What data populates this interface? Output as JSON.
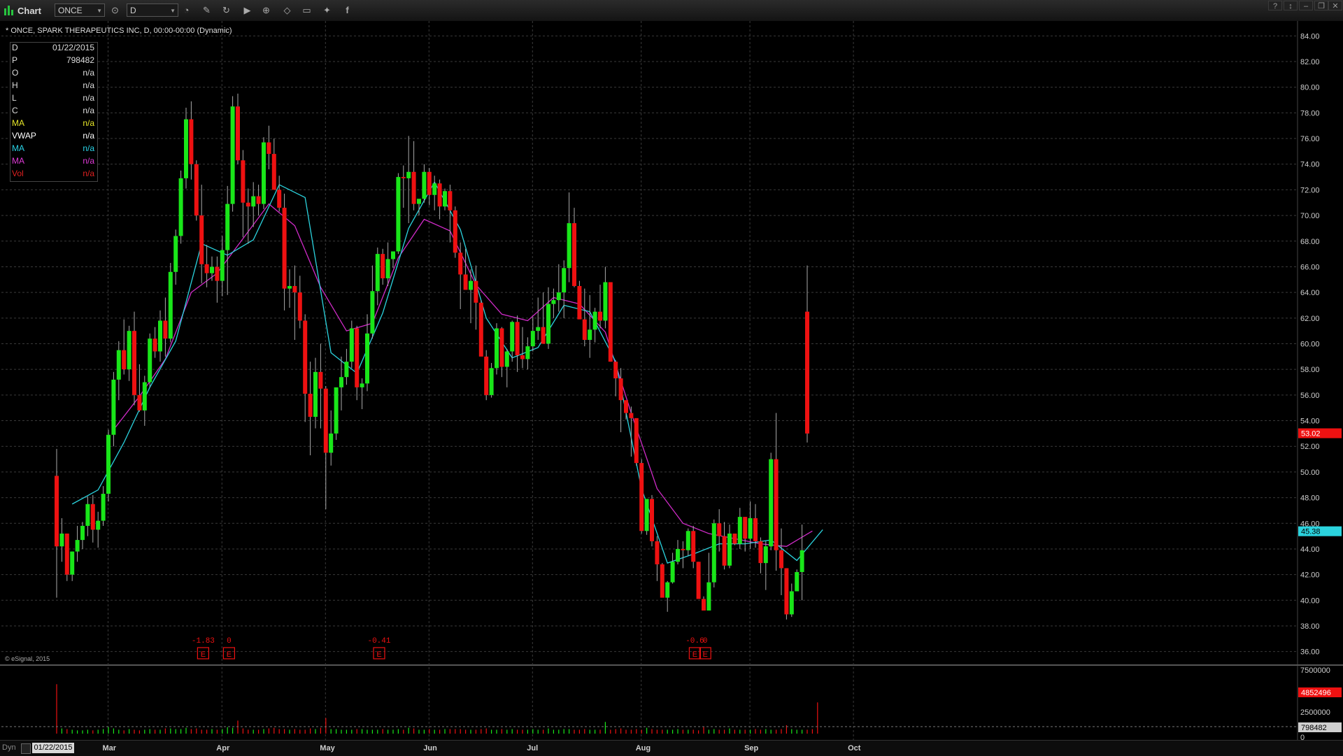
{
  "toolbar": {
    "title": "Chart",
    "symbol": "ONCE",
    "interval": "D"
  },
  "chart": {
    "symbol_line": "* ONCE, SPARK THERAPEUTICS INC, D, 00:00-00:00 (Dynamic)",
    "copyright": "© eSignal, 2015",
    "dyn_label": "Dyn",
    "date_box": "01/22/2015"
  },
  "data_window": [
    {
      "key": "D",
      "value": "01/22/2015",
      "color": "#dddddd"
    },
    {
      "key": "P",
      "value": "798482",
      "color": "#dddddd"
    },
    {
      "key": "O",
      "value": "n/a",
      "color": "#dddddd"
    },
    {
      "key": "H",
      "value": "n/a",
      "color": "#dddddd"
    },
    {
      "key": "L",
      "value": "n/a",
      "color": "#dddddd"
    },
    {
      "key": "C",
      "value": "n/a",
      "color": "#dddddd"
    },
    {
      "key": "MA",
      "value": "n/a",
      "color": "#e8e82a"
    },
    {
      "key": "VWAP",
      "value": "n/a",
      "color": "#ffffff"
    },
    {
      "key": "MA",
      "value": "n/a",
      "color": "#2ad4e8"
    },
    {
      "key": "MA",
      "value": "n/a",
      "color": "#e03ad8"
    },
    {
      "key": "Vol",
      "value": "n/a",
      "color": "#e02020"
    }
  ],
  "colors": {
    "up": "#19e619",
    "down": "#ee1111",
    "ma_fast": "#2bd3de",
    "ma_slow": "#d02bc8",
    "grid": "#3a3a3a",
    "last_price": "#ee1111",
    "ma_badge": "#2bd3de"
  },
  "price_axis": {
    "ticks": [
      "84.00",
      "82.00",
      "80.00",
      "78.00",
      "76.00",
      "74.00",
      "72.00",
      "70.00",
      "68.00",
      "66.00",
      "64.00",
      "62.00",
      "60.00",
      "58.00",
      "56.00",
      "54.00",
      "52.00",
      "50.00",
      "48.00",
      "46.00",
      "44.00",
      "42.00",
      "40.00",
      "38.00",
      "36.00"
    ],
    "last_price": "53.02",
    "ma_value": "45.38"
  },
  "volume_axis": {
    "ticks": [
      "7500000",
      "2500000",
      "0"
    ],
    "last_volume": "4852496",
    "cursor_volume": "798482"
  },
  "months": [
    "Mar",
    "Apr",
    "May",
    "Jun",
    "Jul",
    "Aug",
    "Sep",
    "Oct"
  ],
  "earnings": [
    {
      "label": "-1.83",
      "icon": "E"
    },
    {
      "label": "0",
      "icon": "E"
    },
    {
      "label": "-0.41",
      "icon": "E"
    },
    {
      "label": "-0.6",
      "icon": "E"
    },
    {
      "label": "0",
      "icon": "E"
    }
  ],
  "chart_data": {
    "type": "candlestick",
    "ylim": [
      35,
      85
    ],
    "candles": [
      [
        49.7,
        51.8,
        40.2,
        44.2
      ],
      [
        44.2,
        46.4,
        43.0,
        45.2
      ],
      [
        45.2,
        45.2,
        41.5,
        42.0
      ],
      [
        42.0,
        43.8,
        41.5,
        43.8
      ],
      [
        43.8,
        45.8,
        43.0,
        44.7
      ],
      [
        44.7,
        46.1,
        44.0,
        45.8
      ],
      [
        45.8,
        48.1,
        45.0,
        47.5
      ],
      [
        47.5,
        48.2,
        44.5,
        45.5
      ],
      [
        45.5,
        46.9,
        44.1,
        46.2
      ],
      [
        46.2,
        48.9,
        45.8,
        48.3
      ],
      [
        48.3,
        53.3,
        47.7,
        52.9
      ],
      [
        52.9,
        57.8,
        52.0,
        57.2
      ],
      [
        57.2,
        60.2,
        55.6,
        59.5
      ],
      [
        59.5,
        61.9,
        57.6,
        58.0
      ],
      [
        58.0,
        61.4,
        57.1,
        61.0
      ],
      [
        61.0,
        62.5,
        55.2,
        56.0
      ],
      [
        56.0,
        58.4,
        54.7,
        54.8
      ],
      [
        54.8,
        57.5,
        53.6,
        57.0
      ],
      [
        57.0,
        60.8,
        56.6,
        60.4
      ],
      [
        60.4,
        61.3,
        58.9,
        59.4
      ],
      [
        59.4,
        62.6,
        58.6,
        61.8
      ],
      [
        61.8,
        63.6,
        59.0,
        60.4
      ],
      [
        60.4,
        66.3,
        60.1,
        65.6
      ],
      [
        65.6,
        68.9,
        64.6,
        68.4
      ],
      [
        68.4,
        73.5,
        67.8,
        72.9
      ],
      [
        72.9,
        78.4,
        72.1,
        77.5
      ],
      [
        77.5,
        78.9,
        72.8,
        74.0
      ],
      [
        74.0,
        74.3,
        69.6,
        70.0
      ],
      [
        70.0,
        72.4,
        64.7,
        66.2
      ],
      [
        66.2,
        67.7,
        64.4,
        65.5
      ],
      [
        65.5,
        66.8,
        64.9,
        66.0
      ],
      [
        66.0,
        66.8,
        63.2,
        64.9
      ],
      [
        64.9,
        68.4,
        63.7,
        67.3
      ],
      [
        67.3,
        72.3,
        63.8,
        70.9
      ],
      [
        70.9,
        79.3,
        70.3,
        78.5
      ],
      [
        78.5,
        79.5,
        74.0,
        74.3
      ],
      [
        74.3,
        75.1,
        68.3,
        71.0
      ],
      [
        71.0,
        72.1,
        67.8,
        70.7
      ],
      [
        70.7,
        72.6,
        69.1,
        71.5
      ],
      [
        71.5,
        72.4,
        70.0,
        70.9
      ],
      [
        70.9,
        76.1,
        70.5,
        75.7
      ],
      [
        75.7,
        77.0,
        73.6,
        74.8
      ],
      [
        74.8,
        76.0,
        72.3,
        72.0
      ],
      [
        72.0,
        73.1,
        70.3,
        70.6
      ],
      [
        70.6,
        71.7,
        62.6,
        64.3
      ],
      [
        64.3,
        65.8,
        62.8,
        64.5
      ],
      [
        64.5,
        66.1,
        60.3,
        64.0
      ],
      [
        64.0,
        65.3,
        61.2,
        61.8
      ],
      [
        61.8,
        62.3,
        53.9,
        56.1
      ],
      [
        56.1,
        58.6,
        51.3,
        54.3
      ],
      [
        54.3,
        58.9,
        53.4,
        57.8
      ],
      [
        57.8,
        60.0,
        53.4,
        56.5
      ],
      [
        56.5,
        56.7,
        47.1,
        51.5
      ],
      [
        51.5,
        54.8,
        50.5,
        53.0
      ],
      [
        53.0,
        56.5,
        52.5,
        56.6
      ],
      [
        56.6,
        59.0,
        54.8,
        57.4
      ],
      [
        57.4,
        59.6,
        56.8,
        58.6
      ],
      [
        58.6,
        61.8,
        58.1,
        61.2
      ],
      [
        61.2,
        61.4,
        55.6,
        56.6
      ],
      [
        56.6,
        57.3,
        54.9,
        56.9
      ],
      [
        56.9,
        62.3,
        56.3,
        60.8
      ],
      [
        60.8,
        66.1,
        60.4,
        64.1
      ],
      [
        64.1,
        67.5,
        63.0,
        67.0
      ],
      [
        67.0,
        67.4,
        64.6,
        65.1
      ],
      [
        65.1,
        67.9,
        64.5,
        66.6
      ],
      [
        66.6,
        67.1,
        65.9,
        67.2
      ],
      [
        67.2,
        73.3,
        67.0,
        73.0
      ],
      [
        73.0,
        73.9,
        70.6,
        72.9
      ],
      [
        72.9,
        76.2,
        69.4,
        73.4
      ],
      [
        73.4,
        75.8,
        70.4,
        70.9
      ],
      [
        70.9,
        71.2,
        70.0,
        71.3
      ],
      [
        71.3,
        74.0,
        71.0,
        73.4
      ],
      [
        73.4,
        73.7,
        70.8,
        71.6
      ],
      [
        71.6,
        73.1,
        70.4,
        72.5
      ],
      [
        72.5,
        72.8,
        69.7,
        70.7
      ],
      [
        70.7,
        72.1,
        70.4,
        71.9
      ],
      [
        71.9,
        72.4,
        67.9,
        70.4
      ],
      [
        70.4,
        70.7,
        66.7,
        67.1
      ],
      [
        67.1,
        67.9,
        62.7,
        65.4
      ],
      [
        65.4,
        67.4,
        64.2,
        64.2
      ],
      [
        64.2,
        65.8,
        61.6,
        64.9
      ],
      [
        64.9,
        66.1,
        61.1,
        63.2
      ],
      [
        63.2,
        63.4,
        59.7,
        59.0
      ],
      [
        59.0,
        59.5,
        55.6,
        56.0
      ],
      [
        56.0,
        58.5,
        55.8,
        58.1
      ],
      [
        58.1,
        61.6,
        57.6,
        61.2
      ],
      [
        61.2,
        61.3,
        57.4,
        58.2
      ],
      [
        58.2,
        59.6,
        56.6,
        59.4
      ],
      [
        59.4,
        61.8,
        58.6,
        61.7
      ],
      [
        61.7,
        62.2,
        57.8,
        59.1
      ],
      [
        59.1,
        61.3,
        58.1,
        58.8
      ],
      [
        58.8,
        60.5,
        58.0,
        59.8
      ],
      [
        59.8,
        62.1,
        59.4,
        61.0
      ],
      [
        61.0,
        63.6,
        60.3,
        61.3
      ],
      [
        61.3,
        64.0,
        60.3,
        60.0
      ],
      [
        60.0,
        64.4,
        59.6,
        63.1
      ],
      [
        63.1,
        64.3,
        62.0,
        63.4
      ],
      [
        63.4,
        66.2,
        62.5,
        64.0
      ],
      [
        64.0,
        66.5,
        62.0,
        65.9
      ],
      [
        65.9,
        71.8,
        64.8,
        69.4
      ],
      [
        69.4,
        70.6,
        64.4,
        64.5
      ],
      [
        64.5,
        64.9,
        62.0,
        61.9
      ],
      [
        61.9,
        64.3,
        59.8,
        60.3
      ],
      [
        60.3,
        63.8,
        58.9,
        61.1
      ],
      [
        61.1,
        62.8,
        60.1,
        62.5
      ],
      [
        62.5,
        64.6,
        61.2,
        61.8
      ],
      [
        61.8,
        66.0,
        61.2,
        64.8
      ],
      [
        64.8,
        64.2,
        58.6,
        58.6
      ],
      [
        58.6,
        58.7,
        55.9,
        57.3
      ],
      [
        57.3,
        58.1,
        53.1,
        55.6
      ],
      [
        55.6,
        55.3,
        54.1,
        54.6
      ],
      [
        54.6,
        55.1,
        51.2,
        54.2
      ],
      [
        54.2,
        54.1,
        50.5,
        50.7
      ],
      [
        50.7,
        51.0,
        45.2,
        45.4
      ],
      [
        45.4,
        47.7,
        45.1,
        47.9
      ],
      [
        47.9,
        48.2,
        44.2,
        44.6
      ],
      [
        44.6,
        45.0,
        41.5,
        42.8
      ],
      [
        42.8,
        42.9,
        40.6,
        40.2
      ],
      [
        40.2,
        41.5,
        39.1,
        41.4
      ],
      [
        41.4,
        43.7,
        41.3,
        43.0
      ],
      [
        43.0,
        44.7,
        42.8,
        44.0
      ],
      [
        44.0,
        44.6,
        42.5,
        43.9
      ],
      [
        43.9,
        45.6,
        43.5,
        45.4
      ],
      [
        45.4,
        45.8,
        42.5,
        43.0
      ],
      [
        43.0,
        43.0,
        41.4,
        40.1
      ],
      [
        40.1,
        40.3,
        39.2,
        39.2
      ],
      [
        39.2,
        43.7,
        39.3,
        41.4
      ],
      [
        41.4,
        46.3,
        41.0,
        46.0
      ],
      [
        46.0,
        47.1,
        43.8,
        45.0
      ],
      [
        45.0,
        46.1,
        42.4,
        42.7
      ],
      [
        42.7,
        45.9,
        42.5,
        45.2
      ],
      [
        45.2,
        45.1,
        44.3,
        44.4
      ],
      [
        44.4,
        47.2,
        44.0,
        46.5
      ],
      [
        46.5,
        46.5,
        43.8,
        44.8
      ],
      [
        44.8,
        47.7,
        44.0,
        46.4
      ],
      [
        46.4,
        47.5,
        44.1,
        44.6
      ],
      [
        44.6,
        44.9,
        42.1,
        42.9
      ],
      [
        42.9,
        44.6,
        40.8,
        44.2
      ],
      [
        44.2,
        51.5,
        43.9,
        51.0
      ],
      [
        51.0,
        54.6,
        42.3,
        43.9
      ],
      [
        43.9,
        45.6,
        40.4,
        42.5
      ],
      [
        42.5,
        42.5,
        38.5,
        38.9
      ],
      [
        38.9,
        41.3,
        38.7,
        40.7
      ],
      [
        40.7,
        42.4,
        40.7,
        42.2
      ],
      [
        42.2,
        45.9,
        40.0,
        43.9
      ],
      [
        62.5,
        66.1,
        52.3,
        53.0
      ]
    ],
    "ma_fast": [
      [
        44.2,
        47.5
      ],
      [
        52.9,
        48.6
      ],
      [
        58.0,
        52.3
      ],
      [
        61.0,
        56.6
      ],
      [
        65.6,
        60.2
      ],
      [
        77.5,
        67.8
      ],
      [
        66.0,
        66.9
      ],
      [
        70.9,
        68.1
      ],
      [
        75.7,
        72.4
      ],
      [
        64.0,
        71.4
      ],
      [
        56.5,
        59.3
      ],
      [
        61.2,
        57.7
      ],
      [
        67.0,
        62.4
      ],
      [
        73.4,
        69.0
      ],
      [
        71.6,
        72.6
      ],
      [
        64.2,
        68.9
      ],
      [
        58.1,
        62.0
      ],
      [
        59.1,
        58.9
      ],
      [
        63.1,
        59.7
      ],
      [
        69.4,
        63.0
      ],
      [
        62.5,
        62.5
      ],
      [
        54.2,
        58.6
      ],
      [
        44.6,
        48.7
      ],
      [
        43.9,
        42.9
      ],
      [
        45.2,
        43.6
      ],
      [
        46.4,
        44.4
      ],
      [
        42.9,
        44.4
      ],
      [
        43.9,
        44.7
      ],
      [
        42.2,
        43.1
      ],
      [
        53.0,
        45.5
      ]
    ],
    "ma_slow": [
      [
        57.2,
        53.3
      ],
      [
        61.0,
        55.9
      ],
      [
        65.6,
        58.8
      ],
      [
        77.5,
        64.0
      ],
      [
        66.0,
        65.5
      ],
      [
        70.9,
        68.2
      ],
      [
        75.7,
        70.9
      ],
      [
        64.0,
        69.2
      ],
      [
        56.5,
        64.4
      ],
      [
        61.2,
        61.0
      ],
      [
        67.0,
        61.6
      ],
      [
        73.4,
        66.7
      ],
      [
        71.6,
        69.7
      ],
      [
        64.2,
        68.8
      ],
      [
        58.1,
        64.6
      ],
      [
        59.1,
        62.3
      ],
      [
        63.1,
        61.8
      ],
      [
        69.4,
        63.6
      ],
      [
        62.5,
        63.1
      ],
      [
        54.2,
        60.9
      ],
      [
        44.6,
        54.6
      ],
      [
        43.9,
        48.7
      ],
      [
        45.2,
        46.0
      ],
      [
        46.4,
        45.2
      ],
      [
        42.9,
        44.8
      ],
      [
        43.9,
        44.4
      ],
      [
        42.2,
        44.2
      ],
      [
        53.0,
        45.4
      ]
    ],
    "volume": [
      0.76,
      0.08,
      0.07,
      0.06,
      0.05,
      0.05,
      0.06,
      0.05,
      0.06,
      0.07,
      0.1,
      0.08,
      0.06,
      0.05,
      0.07,
      0.06,
      0.05,
      0.06,
      0.07,
      0.06,
      0.06,
      0.08,
      0.08,
      0.07,
      0.07,
      0.09,
      0.07,
      0.08,
      0.06,
      0.06,
      0.07,
      0.06,
      0.07,
      0.1,
      0.09,
      0.2,
      0.08,
      0.06,
      0.06,
      0.06,
      0.07,
      0.08,
      0.09,
      0.07,
      0.07,
      0.06,
      0.07,
      0.06,
      0.06,
      0.08,
      0.07,
      0.09,
      0.24,
      0.07,
      0.07,
      0.06,
      0.06,
      0.06,
      0.07,
      0.07,
      0.06,
      0.06,
      0.06,
      0.07,
      0.06,
      0.06,
      0.07,
      0.06,
      0.09,
      0.08,
      0.06,
      0.06,
      0.07,
      0.06,
      0.06,
      0.07,
      0.07,
      0.07,
      0.07,
      0.06,
      0.06,
      0.06,
      0.07,
      0.08,
      0.06,
      0.06,
      0.07,
      0.06,
      0.07,
      0.06,
      0.06,
      0.06,
      0.07,
      0.06,
      0.06,
      0.08,
      0.06,
      0.06,
      0.07,
      0.07,
      0.06,
      0.06,
      0.07,
      0.06,
      0.06,
      0.06,
      0.18,
      0.06,
      0.07,
      0.08,
      0.06,
      0.06,
      0.07,
      0.06,
      0.09,
      0.07,
      0.06,
      0.06,
      0.06,
      0.06,
      0.07,
      0.06,
      0.06,
      0.06,
      0.05,
      0.1,
      0.06,
      0.07,
      0.06,
      0.06,
      0.08,
      0.06,
      0.06,
      0.06,
      0.06,
      0.07,
      0.06,
      0.07,
      0.06,
      0.06,
      0.07,
      0.13,
      0.07,
      0.06,
      0.06,
      0.06,
      0.07,
      0.48
    ]
  }
}
